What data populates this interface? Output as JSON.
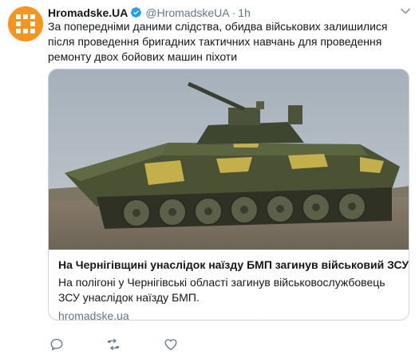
{
  "tweet": {
    "display_name": "Hromadske.UA",
    "verified_icon": "verified-badge-icon",
    "handle": "@HromadskeUA",
    "separator": "·",
    "time": "1h",
    "text": "За попередніми даними слідства, обидва військових залишилися після проведення бригадних тактичних навчань для проведення ремонту двох бойових машин піхоти",
    "avatar_icon": "hromadske-logo-icon"
  },
  "card": {
    "image_icon": "bmp-tank-photo",
    "title": "На Чернігівщині унаслідок наїзду БМП загинув військовий ЗСУ",
    "description": "На полігоні у Чернігівські області загинув військовослужбовець ЗСУ унаслідок наїзду БМП.",
    "domain": "hromadske.ua"
  },
  "actions": {
    "reply_icon": "reply-icon",
    "retweet_icon": "retweet-icon",
    "like_icon": "heart-icon"
  },
  "colors": {
    "brand": "#f7941d",
    "verified": "#1da1f2",
    "muted": "#657786",
    "border": "#ccd6dd"
  }
}
